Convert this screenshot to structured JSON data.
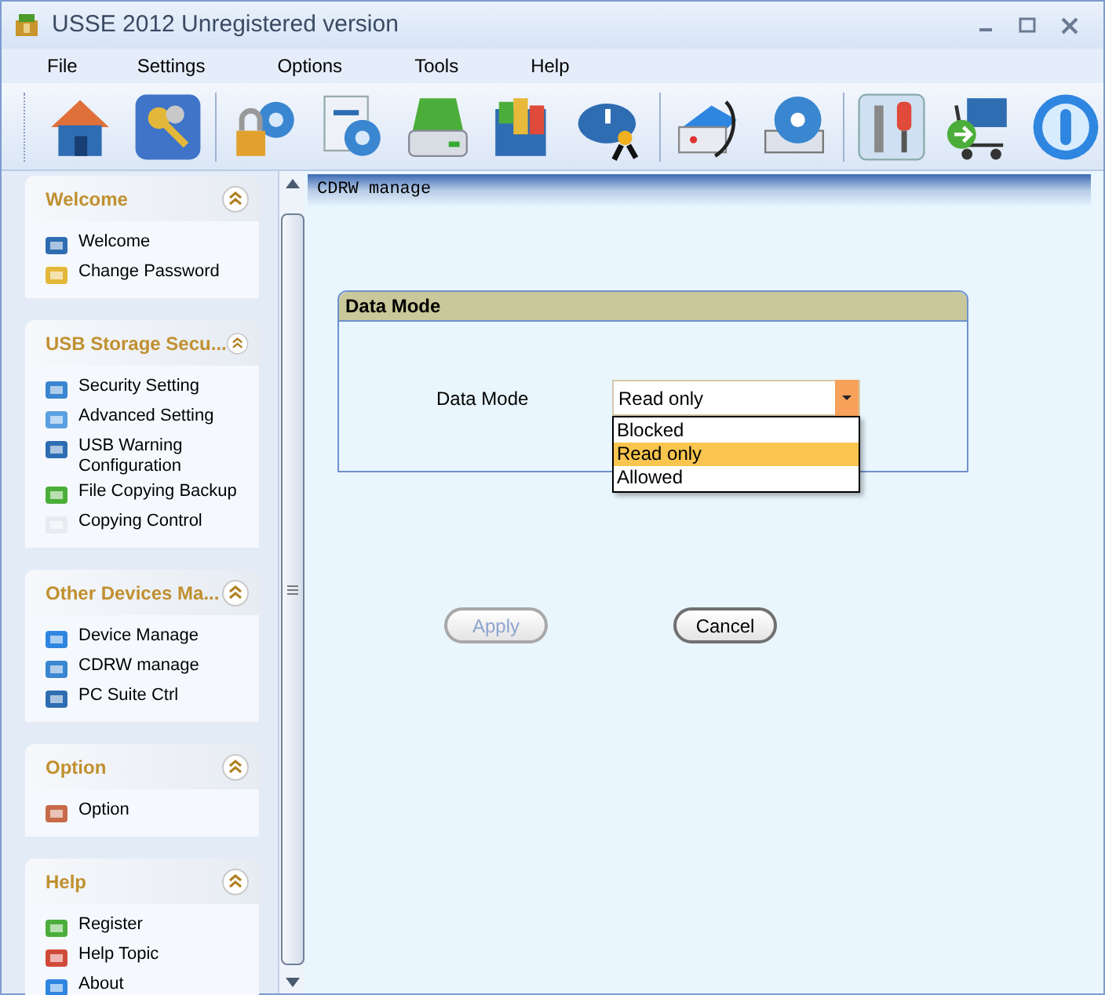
{
  "window": {
    "title": "USSE 2012 Unregistered version"
  },
  "menu": [
    "File",
    "Settings",
    "Options",
    "Tools",
    "Help"
  ],
  "sidebar": [
    {
      "title": "Welcome",
      "expanded": true,
      "items": [
        {
          "label": "Welcome"
        },
        {
          "label": "Change Password"
        }
      ]
    },
    {
      "title": "USB Storage Secu...",
      "expanded": true,
      "items": [
        {
          "label": "Security Setting"
        },
        {
          "label": "Advanced Setting"
        },
        {
          "label": "USB Warning Configuration"
        },
        {
          "label": "File Copying Backup"
        },
        {
          "label": "Copying Control"
        }
      ]
    },
    {
      "title": "Other Devices Ma...",
      "expanded": true,
      "items": [
        {
          "label": "Device Manage"
        },
        {
          "label": "CDRW manage"
        },
        {
          "label": "PC Suite Ctrl"
        }
      ]
    },
    {
      "title": "Option",
      "expanded": true,
      "items": [
        {
          "label": "Option"
        }
      ]
    },
    {
      "title": "Help",
      "expanded": true,
      "items": [
        {
          "label": "Register"
        },
        {
          "label": "Help Topic"
        },
        {
          "label": "About"
        }
      ]
    }
  ],
  "content": {
    "header": "CDRW manage",
    "group_title": "Data Mode",
    "field_label": "Data Mode",
    "value": "Read only",
    "options": [
      {
        "label": "Blocked",
        "selected": false
      },
      {
        "label": "Read only",
        "selected": true
      },
      {
        "label": "Allowed",
        "selected": false
      }
    ],
    "buttons": [
      {
        "label": "Apply",
        "disabled": true
      },
      {
        "label": "Cancel",
        "disabled": false
      }
    ]
  }
}
